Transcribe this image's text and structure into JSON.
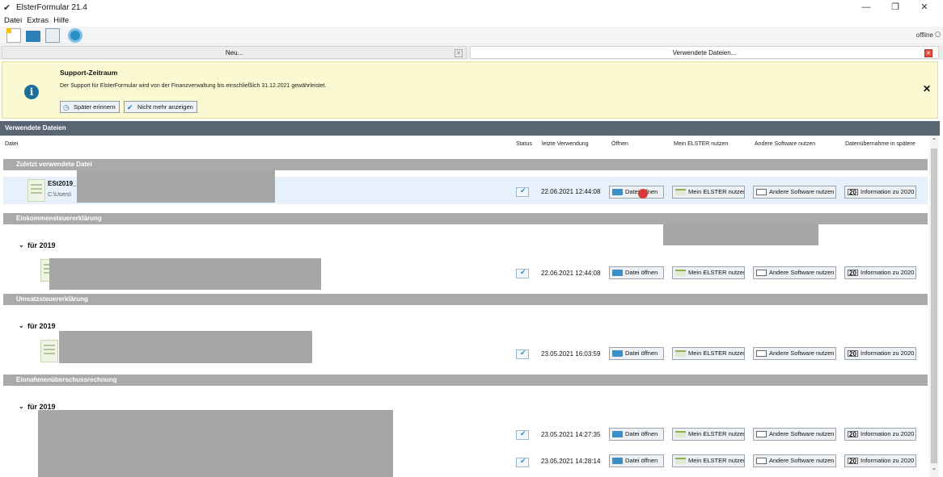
{
  "window": {
    "title": "ElsterFormular 21.4",
    "controls": {
      "minimize": "—",
      "restore": "❐",
      "close": "✕"
    }
  },
  "menu": [
    "Datei",
    "Extras",
    "Hilfe"
  ],
  "toolbar": {
    "icons": [
      "new-file-icon",
      "open-folder-icon",
      "list-icon",
      "refresh-icon"
    ],
    "status": "offline"
  },
  "tabs": [
    {
      "label": "Neu...",
      "active": false
    },
    {
      "label": "Verwendete Dateien...",
      "active": true
    }
  ],
  "banner": {
    "title": "Support-Zeitraum",
    "text": "Der Support für ElsterFormular wird von der Finanzverwaltung bis einschließlich 31.12.2021 gewährleistet.",
    "remind_label": "Später erinnern",
    "dismiss_label": "Nicht mehr anzeigen",
    "close_label": "✕"
  },
  "section_title": "Verwendete Dateien",
  "columns": {
    "file": "Datei",
    "status": "Status",
    "last_used": "letzte Verwendung",
    "open": "Öffnen",
    "elster": "Mein ELSTER nutzen",
    "other": "Andere Software nutzen",
    "transfer": "Datenübernahme in spätere"
  },
  "groups": {
    "recent": "Zuletzt verwendete Datei",
    "est": "Einkommensteuererklärung",
    "ust": "Umsatzsteuererklärung",
    "eur": "Einnahmenüberschussrechnung"
  },
  "year_label": "für 2019",
  "recent_file": {
    "name": "ESt2019_",
    "path": "C:\\Users\\"
  },
  "rows": [
    {
      "date": "22.06.2021 12:44:08"
    },
    {
      "date": "22.06.2021 12:44:08"
    },
    {
      "date": "23.05.2021 16:03:59"
    },
    {
      "date": "23.05.2021 14:27:35"
    },
    {
      "date": "23.05.2021 14:28:14"
    }
  ],
  "buttons": {
    "open": "Datei öffnen",
    "elster": "Mein ELSTER nutzen",
    "other": "Andere Software nutzen",
    "info": "Information zu 2020",
    "info_icon": "20"
  }
}
